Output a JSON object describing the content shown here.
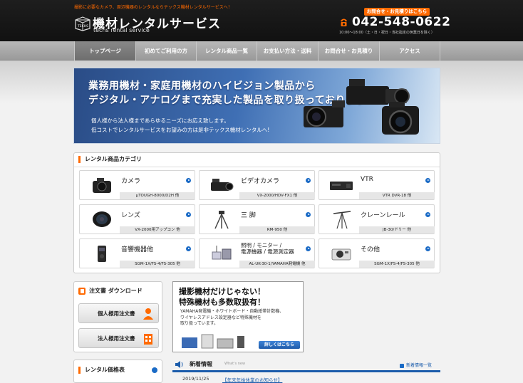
{
  "header": {
    "tagline": "撮影に必要なカメラ、周辺機器のレンタルならテックス機材レンタルサービスへ！",
    "logo_text": "TECHS",
    "title": "機材レンタルサービス",
    "subtitle": "techs rental service",
    "contact_button": "お問合せ・お見積りはこちら",
    "phone": "042-548-0622",
    "hours": "10:00〜18:00（土・日・祝日・当社指定の休業日を除く）"
  },
  "nav": {
    "items": [
      {
        "label": "トップページ"
      },
      {
        "label": "初めてご利用の方"
      },
      {
        "label": "レンタル商品一覧"
      },
      {
        "label": "お支払い方法・送料"
      },
      {
        "label": "お問合せ・お見積り"
      },
      {
        "label": "アクセス"
      }
    ]
  },
  "hero": {
    "line1": "業務用機材・家庭用機材のハイビジョン製品から",
    "line2": "デジタル・アナログまで充実した製品を取り扱っております",
    "sub1": "個人様から法人様まであらゆるニーズにお応え致します。",
    "sub2": "低コストでレンタルサービスをお望みの方は是非テックス機材レンタルへ!"
  },
  "categories": {
    "heading": "レンタル商品カテゴリ",
    "items": [
      {
        "name": "カメラ",
        "model": "μTOUGH-8000/D2H 他"
      },
      {
        "name": "ビデオカメラ",
        "model": "VX-2000/HDV-FX1 他"
      },
      {
        "name": "VTR",
        "model": "VTR DVR-18 他"
      },
      {
        "name": "レンズ",
        "model": "VX-2000用アップコン 他"
      },
      {
        "name": "三 脚",
        "model": "RM-950 他"
      },
      {
        "name": "クレーンレール",
        "model": "JB-30/ドリー 他"
      },
      {
        "name": "音響機器他",
        "model": "SGM-1X/FS-4/FS-305 他"
      },
      {
        "name": "照明 / モニター /",
        "name2": "電源機器 / 電源測定器",
        "model": "AL-UK-30-1/YAMAHA発電機 他"
      },
      {
        "name": "その他",
        "model": "SGM-1X/FS-4/FS-305 他"
      }
    ]
  },
  "order": {
    "heading": "注文書 ダウンロード",
    "personal": "個人様用注文書",
    "corporate": "法人様用注文書"
  },
  "pricelist": {
    "heading": "レンタル価格表"
  },
  "promo": {
    "title1": "撮影機材だけじゃない！",
    "title2": "特殊機材も多数取扱有！",
    "p1": "YAMAHA発電機・ホワイトボード・自動紙帯計数機、",
    "p2": "ワイヤレスアドレス設定器など特殊機材を",
    "p3": "取り扱っています。",
    "button": "詳しくはこちら"
  },
  "news": {
    "title": "新着情報",
    "subtitle": "What's new",
    "list_link": "新着情報一覧",
    "items": [
      {
        "date": "2019/11/25",
        "text": "【年末年始休業のお知らせ】"
      }
    ]
  },
  "colors": {
    "accent": "#ff6a00",
    "link": "#1b5cab",
    "header_bg": "#151515"
  }
}
